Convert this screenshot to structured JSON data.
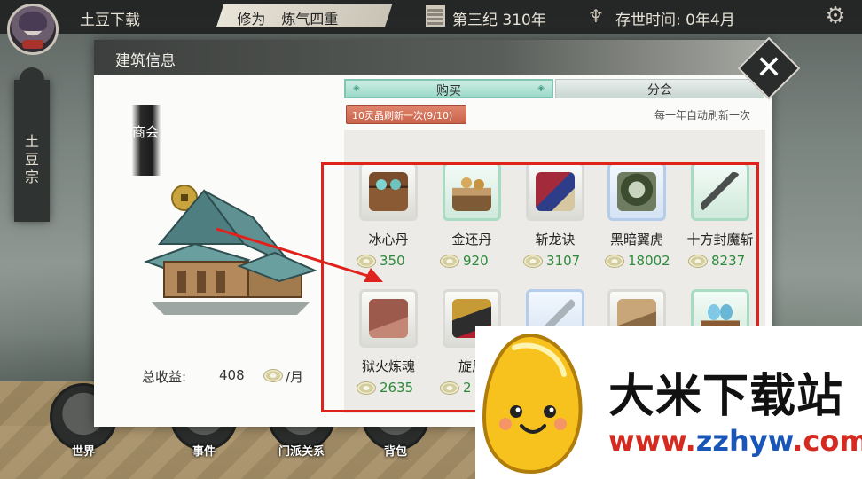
{
  "topbar": {
    "player_name": "土豆下载",
    "realm_label": "修为",
    "realm_value": "炼气四重",
    "era": "第三纪 310年",
    "exist_time": "存世时间: 0年4月",
    "icons": [
      "avatar",
      "era-icon",
      "tree-icon",
      "gear-icon"
    ]
  },
  "sect": {
    "name": "土豆宗"
  },
  "nav": [
    {
      "label": "世界"
    },
    {
      "label": "事件"
    },
    {
      "label": "门派关系"
    },
    {
      "label": "背包"
    }
  ],
  "modal": {
    "title": "建筑信息",
    "building_sign": "商会",
    "income_label": "总收益:",
    "income_value": "408",
    "income_unit": "/月",
    "tabs": [
      {
        "label": "购买",
        "active": true
      },
      {
        "label": "分会",
        "active": false
      }
    ],
    "refresh_button": "10灵晶刷新一次(9/10)",
    "auto_refresh": "每一年自动刷新一次",
    "items": [
      {
        "name": "冰心丹",
        "price": "350",
        "icon": "chest-icon",
        "rarity": "gray"
      },
      {
        "name": "金还丹",
        "price": "920",
        "icon": "tray-icon",
        "rarity": "green"
      },
      {
        "name": "斩龙诀",
        "price": "3107",
        "icon": "book-icon",
        "rarity": "gray"
      },
      {
        "name": "黑暗翼虎",
        "price": "18002",
        "icon": "tiger-icon",
        "rarity": "blue"
      },
      {
        "name": "十方封魔斩",
        "price": "8237",
        "icon": "sword-icon",
        "rarity": "green"
      },
      {
        "name": "狱火炼魂",
        "price": "2635",
        "icon": "tome-icon",
        "rarity": "gray"
      },
      {
        "name": "旋风",
        "price": "2",
        "icon": "scroll-icon",
        "rarity": "gray"
      },
      {
        "name": "",
        "price": "",
        "icon": "blade-icon",
        "rarity": "blue"
      },
      {
        "name": "",
        "price": "",
        "icon": "material-icon",
        "rarity": "gray"
      },
      {
        "name": "",
        "price": "",
        "icon": "eggs-icon",
        "rarity": "green"
      }
    ]
  },
  "watermark": {
    "title": "大米下载站",
    "url_prefix": "www.",
    "url_domain": "zzhyw",
    "url_suffix": ".com"
  },
  "colors": {
    "accent_teal": "#9cd9c8",
    "refresh_red": "#c9634a",
    "price_green": "#2d8a3a",
    "highlight_red": "#e0221c"
  }
}
